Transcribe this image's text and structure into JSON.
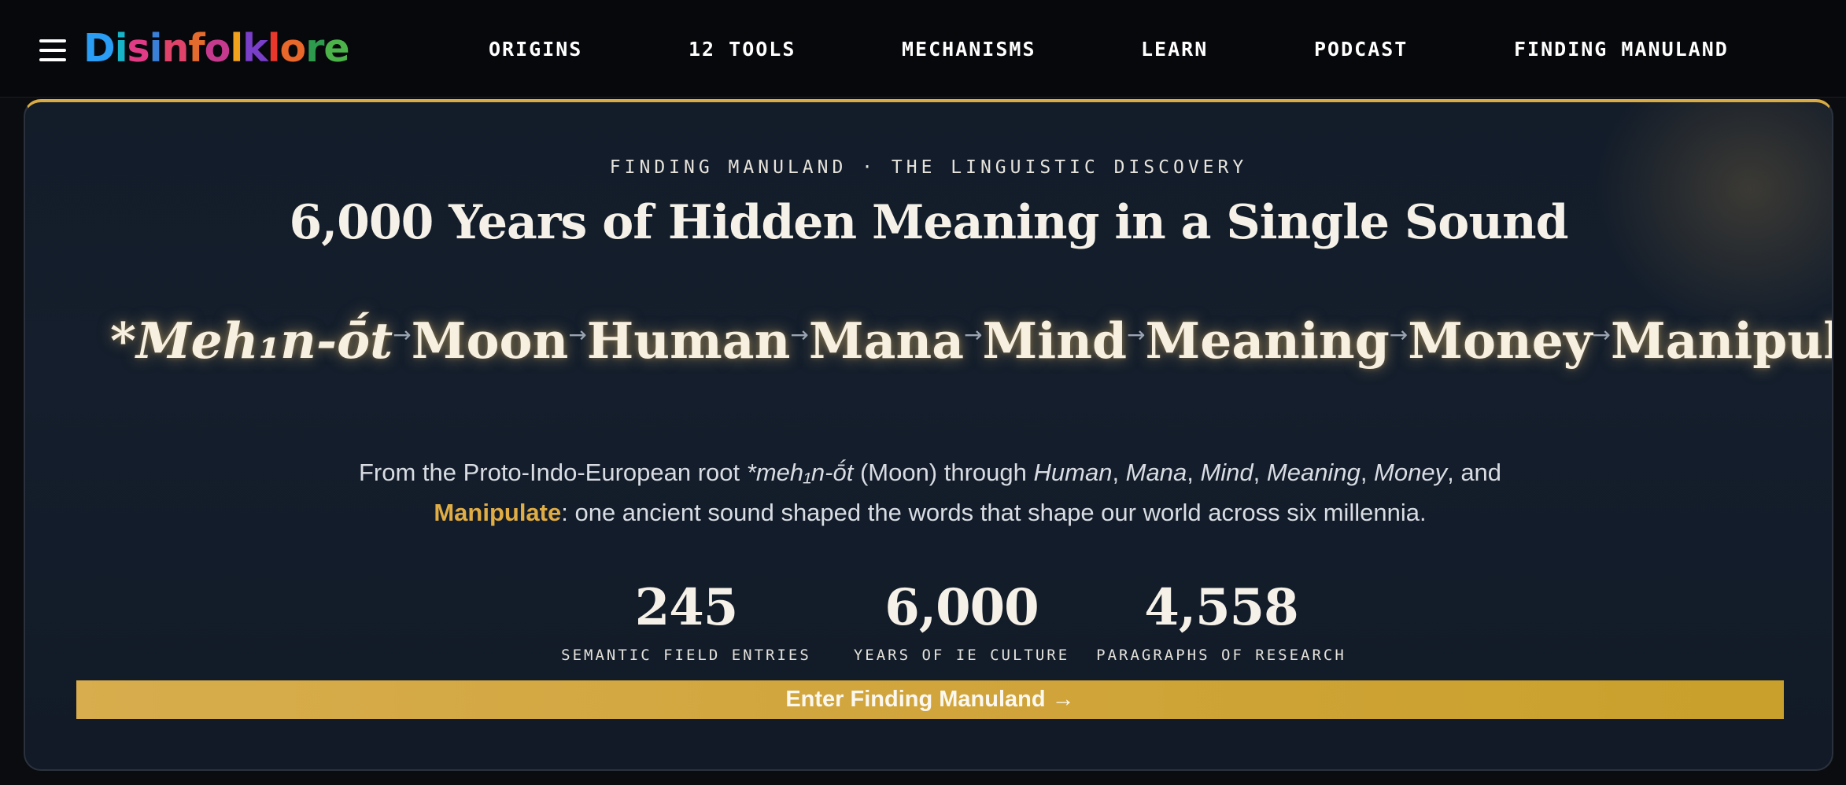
{
  "nav": {
    "menu_icon": "hamburger-menu-icon",
    "logo_letters": [
      {
        "ch": "D",
        "color": "#2a9df4"
      },
      {
        "ch": "i",
        "color": "#17b3c8"
      },
      {
        "ch": "s",
        "color": "#e23b86"
      },
      {
        "ch": "i",
        "color": "#3a7fd8"
      },
      {
        "ch": "n",
        "color": "#e0436a"
      },
      {
        "ch": "f",
        "color": "#e36b2d"
      },
      {
        "ch": "o",
        "color": "#c63a8d"
      },
      {
        "ch": "l",
        "color": "#f0a21d"
      },
      {
        "ch": "k",
        "color": "#7a3fc9"
      },
      {
        "ch": "l",
        "color": "#e8372b"
      },
      {
        "ch": "o",
        "color": "#e8672b"
      },
      {
        "ch": "r",
        "color": "#2e9a4d"
      },
      {
        "ch": "e",
        "color": "#4bb34a"
      }
    ],
    "links": [
      "ORIGINS",
      "12 TOOLS",
      "MECHANISMS",
      "LEARN",
      "PODCAST",
      "FINDING MANULAND"
    ]
  },
  "hero": {
    "eyebrow": "FINDING MANULAND · THE LINGUISTIC DISCOVERY",
    "headline": "6,000 Years of Hidden Meaning in a Single Sound",
    "chain": [
      "*Meh₁n-ṓt",
      "Moon",
      "Human",
      "Mana",
      "Mind",
      "Meaning",
      "Money",
      "Manipulate"
    ],
    "arrow": "→",
    "description": {
      "part1": "From the Proto-Indo-European root ",
      "root": "*meh₁n-ṓt",
      "part2": " (Moon) through ",
      "words": [
        "Human",
        "Mana",
        "Mind",
        "Meaning",
        "Money"
      ],
      "part3": ", and ",
      "highlight": "Manipulate",
      "part4": ": one ancient sound shaped the words that shape our world across six millennia."
    },
    "stats": [
      {
        "value": "245",
        "label": "SEMANTIC FIELD ENTRIES"
      },
      {
        "value": "6,000",
        "label": "YEARS OF IE CULTURE"
      },
      {
        "value": "4,558",
        "label": "PARAGRAPHS OF RESEARCH"
      }
    ],
    "cta_label": "Enter Finding Manuland →"
  },
  "colors": {
    "accent_gold": "#d8ab44",
    "background": "#0a0c10",
    "card": "#141e2c"
  }
}
